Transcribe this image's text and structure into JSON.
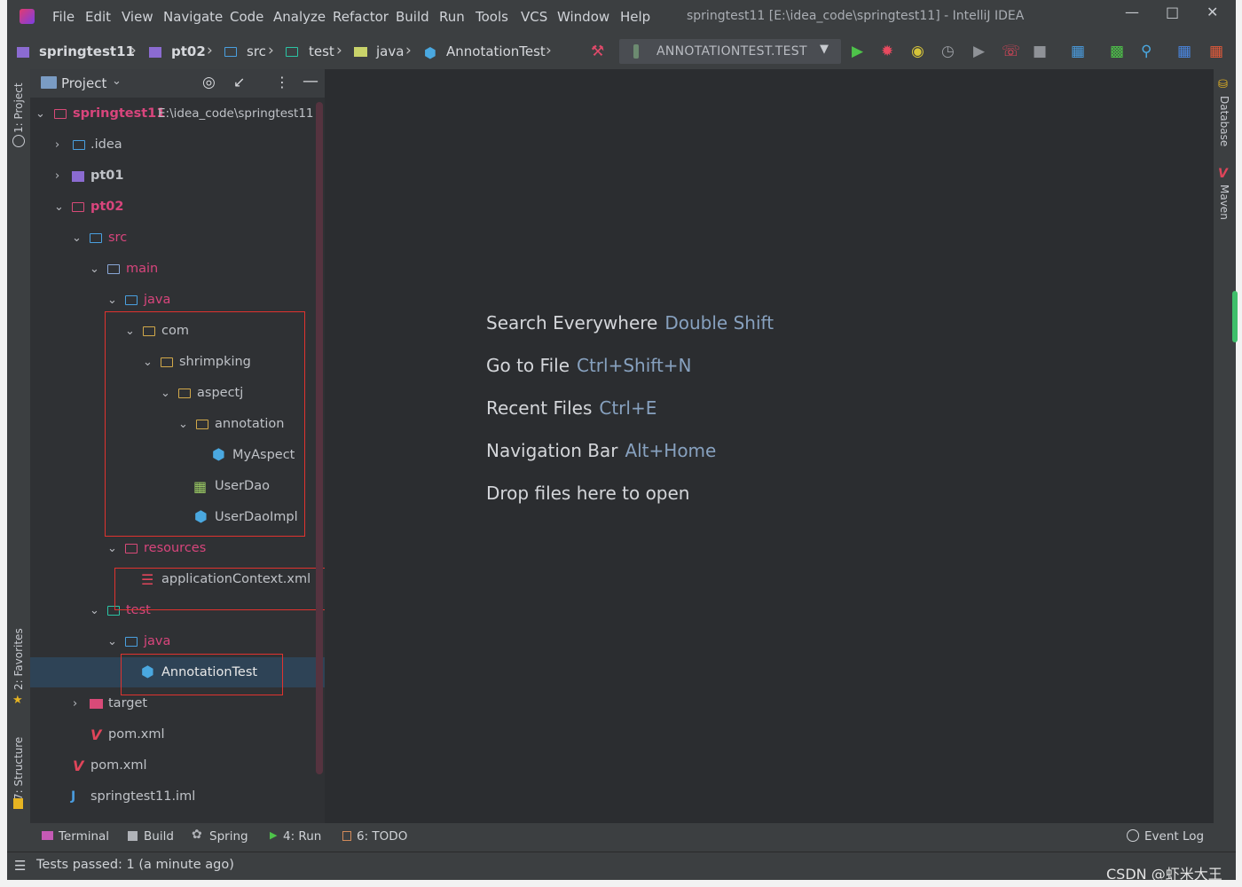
{
  "window": {
    "title": "springtest11 [E:\\idea_code\\springtest11] - IntelliJ IDEA",
    "menu": [
      "File",
      "Edit",
      "View",
      "Navigate",
      "Code",
      "Analyze",
      "Refactor",
      "Build",
      "Run",
      "Tools",
      "VCS",
      "Window",
      "Help"
    ]
  },
  "breadcrumbs": [
    "springtest11",
    "pt02",
    "src",
    "test",
    "java",
    "AnnotationTest"
  ],
  "run_config": "ANNOTATIONTEST.TEST",
  "left_tools": {
    "project": "1: Project",
    "favorites": "2: Favorites",
    "structure": "7: Structure"
  },
  "right_tools": {
    "database": "Database",
    "maven": "Maven"
  },
  "project_panel": {
    "title": "Project",
    "root_name": "springtest11",
    "root_path": "E:\\idea_code\\springtest11",
    "tree": [
      {
        "label": ".idea"
      },
      {
        "label": "pt01"
      },
      {
        "label": "pt02"
      },
      {
        "label": "src"
      },
      {
        "label": "main"
      },
      {
        "label": "java"
      },
      {
        "label": "com"
      },
      {
        "label": "shrimpking"
      },
      {
        "label": "aspectj"
      },
      {
        "label": "annotation"
      },
      {
        "label": "MyAspect"
      },
      {
        "label": "UserDao"
      },
      {
        "label": "UserDaoImpl"
      },
      {
        "label": "resources"
      },
      {
        "label": "applicationContext.xml"
      },
      {
        "label": "test"
      },
      {
        "label": "java"
      },
      {
        "label": "AnnotationTest"
      },
      {
        "label": "target"
      },
      {
        "label": "pom.xml"
      },
      {
        "label": "pom.xml"
      },
      {
        "label": "springtest11.iml"
      }
    ]
  },
  "editor_hints": [
    {
      "action": "Search Everywhere",
      "keys": "Double Shift"
    },
    {
      "action": "Go to File",
      "keys": "Ctrl+Shift+N"
    },
    {
      "action": "Recent Files",
      "keys": "Ctrl+E"
    },
    {
      "action": "Navigation Bar",
      "keys": "Alt+Home"
    },
    {
      "action": "Drop files here to open",
      "keys": ""
    }
  ],
  "tool_windows": [
    "Terminal",
    "Build",
    "Spring",
    "4: Run",
    "6: TODO"
  ],
  "event_log": "Event Log",
  "status": "Tests passed: 1 (a minute ago)",
  "watermark": "CSDN @虾米大王"
}
